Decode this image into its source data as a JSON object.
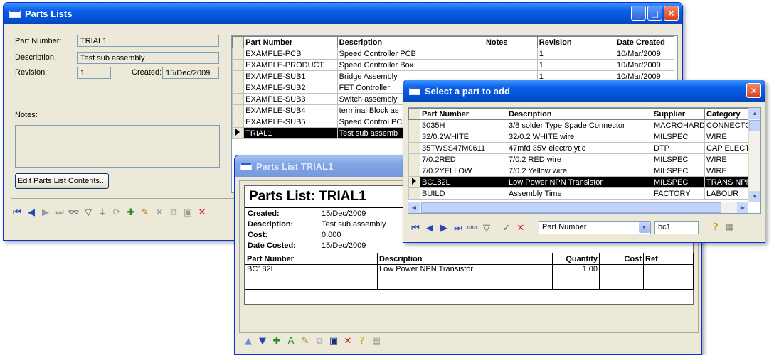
{
  "parts_lists_window": {
    "title": "Parts Lists",
    "part_number_label": "Part Number:",
    "part_number_value": "TRIAL1",
    "description_label": "Description:",
    "description_value": "Test sub assembly",
    "revision_label": "Revision:",
    "revision_value": "1",
    "created_label": "Created:",
    "created_value": "15/Dec/2009",
    "notes_label": "Notes:",
    "edit_button_label": "Edit Parts List Contents...",
    "grid_headers": [
      "Part Number",
      "Description",
      "Notes",
      "Revision",
      "Date Created"
    ],
    "grid_rows": [
      [
        "EXAMPLE-PCB",
        "Speed Controller PCB",
        "",
        "1",
        "10/Mar/2009"
      ],
      [
        "EXAMPLE-PRODUCT",
        "Speed Controller Box",
        "",
        "1",
        "10/Mar/2009"
      ],
      [
        "EXAMPLE-SUB1",
        "Bridge Assembly",
        "",
        "1",
        "10/Mar/2009"
      ],
      [
        "EXAMPLE-SUB2",
        "FET Controller",
        "",
        "",
        ""
      ],
      [
        "EXAMPLE-SUB3",
        "Switch assembly",
        "",
        "",
        ""
      ],
      [
        "EXAMPLE-SUB4",
        "terminal Block as",
        "",
        "",
        ""
      ],
      [
        "EXAMPLE-SUB5",
        "Speed Control PC",
        "",
        "",
        ""
      ],
      [
        "TRIAL1",
        "Test sub assemb",
        "",
        "",
        ""
      ]
    ],
    "selected_row": 7
  },
  "parts_list_report_window": {
    "title": "Parts List TRIAL1",
    "report_title": "Parts List: TRIAL1",
    "created_label": "Created:",
    "created_value": "15/Dec/2009",
    "description_label": "Description:",
    "description_value": "Test sub assembly",
    "cost_label": "Cost:",
    "cost_value": "0.000",
    "date_costed_label": "Date Costed:",
    "date_costed_value": "15/Dec/2009",
    "headers": [
      "Part Number",
      "Description",
      "Quantity",
      "Cost",
      "Ref"
    ],
    "rows": [
      [
        "BC182L",
        "Low Power NPN Transistor",
        "1.00",
        "",
        ""
      ]
    ]
  },
  "select_part_window": {
    "title": "Select a part to add",
    "headers": [
      "Part Number",
      "Description",
      "Supplier",
      "Category"
    ],
    "rows": [
      [
        "3035H",
        "3/8 solder Type Spade Connector",
        "MACROHARD",
        "CONNECTO"
      ],
      [
        "32/0.2WHITE",
        "32/0.2 WHITE wire",
        "MILSPEC",
        "WIRE"
      ],
      [
        "35TWSS47M0611",
        "47mfd 35V electrolytic",
        "DTP",
        "CAP ELECT"
      ],
      [
        "7/0.2RED",
        "7/0.2 RED wire",
        "MILSPEC",
        "WIRE"
      ],
      [
        "7/0.2YELLOW",
        "7/0.2 Yellow wire",
        "MILSPEC",
        "WIRE"
      ],
      [
        "BC182L",
        "Low Power NPN Transistor",
        "MILSPEC",
        "TRANS NPN"
      ],
      [
        "BUILD",
        "Assembly Time",
        "FACTORY",
        "LABOUR"
      ]
    ],
    "selected_row": 5,
    "search_field_value": "Part Number",
    "search_text_value": "bc1"
  }
}
